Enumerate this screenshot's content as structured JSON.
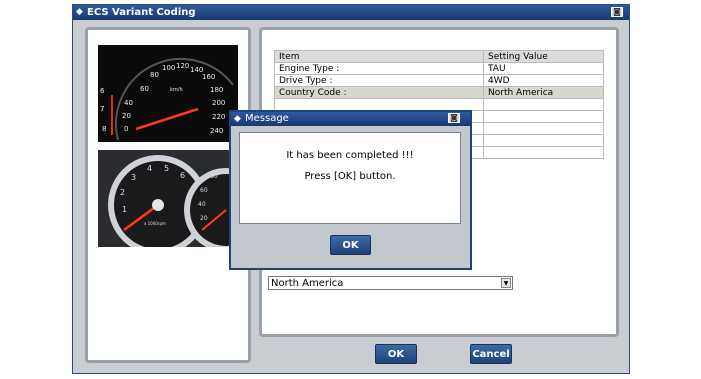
{
  "window": {
    "title": "ECS Variant Coding",
    "title_glyph": "◆"
  },
  "table": {
    "headers": [
      "Item",
      "Setting Value"
    ],
    "rows": [
      [
        "Engine Type :",
        "TAU"
      ],
      [
        "Drive Type :",
        "4WD"
      ],
      [
        "Country Code :",
        "North America"
      ],
      [
        "",
        ""
      ],
      [
        "",
        ""
      ],
      [
        "",
        ""
      ],
      [
        "",
        ""
      ],
      [
        "",
        ""
      ]
    ]
  },
  "country_select": {
    "value": "North America",
    "arrow": "▼"
  },
  "buttons": {
    "ok": "OK",
    "cancel": "Cancel"
  },
  "message_dialog": {
    "title": "Message",
    "line1": "It has been completed !!!",
    "line2": "Press [OK] button.",
    "ok": "OK"
  },
  "speedometer": {
    "ticks": [
      "60",
      "80",
      "100",
      "120",
      "140",
      "160",
      "180",
      "200",
      "220",
      "240"
    ],
    "unit": "km/h",
    "left_ticks": [
      "6",
      "7",
      "8"
    ],
    "left_small": [
      "40",
      "20",
      "0"
    ]
  },
  "tachometer": {
    "ticks": [
      "1",
      "2",
      "3",
      "4",
      "5",
      "6"
    ],
    "unit": "x 1000rpm"
  },
  "temp_gauge": {
    "ticks": [
      "80",
      "60",
      "40",
      "20"
    ]
  }
}
